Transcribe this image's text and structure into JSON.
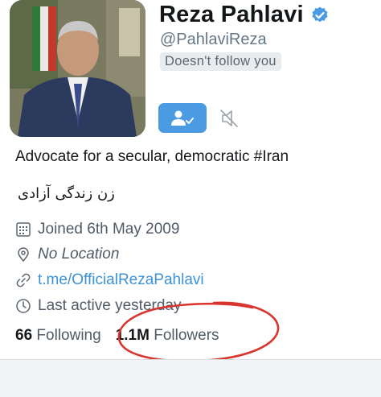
{
  "profile": {
    "name": "Reza Pahlavi",
    "handle": "@PahlaviReza",
    "follow_status": "Doesn't follow you",
    "bio": "Advocate for a secular, democratic #Iran",
    "bio_secondary": "زن زندگی آزادی"
  },
  "meta": {
    "joined": "Joined 6th May 2009",
    "location": "No Location",
    "link": "t.me/OfficialRezaPahlavi",
    "last_active": "Last active yesterday"
  },
  "stats": {
    "following_count": "66",
    "following_label": "Following",
    "followers_count": "1.1M",
    "followers_label": "Followers"
  },
  "colors": {
    "accent": "#4a9be2",
    "link": "#3b92d6",
    "annotation": "#d9352e"
  }
}
